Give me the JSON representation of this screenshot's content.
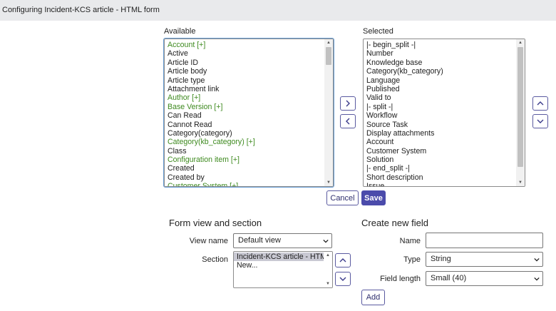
{
  "window": {
    "title": "Configuring Incident-KCS article - HTML form"
  },
  "available": {
    "label": "Available",
    "items": [
      {
        "text": "Account [+]",
        "ref": true
      },
      {
        "text": "Active",
        "ref": false
      },
      {
        "text": "Article ID",
        "ref": false
      },
      {
        "text": "Article body",
        "ref": false
      },
      {
        "text": "Article type",
        "ref": false
      },
      {
        "text": "Attachment link",
        "ref": false
      },
      {
        "text": "Author [+]",
        "ref": true
      },
      {
        "text": "Base Version [+]",
        "ref": true
      },
      {
        "text": "Can Read",
        "ref": false
      },
      {
        "text": "Cannot Read",
        "ref": false
      },
      {
        "text": "Category(category)",
        "ref": false
      },
      {
        "text": "Category(kb_category) [+]",
        "ref": true
      },
      {
        "text": "Class",
        "ref": false
      },
      {
        "text": "Configuration item [+]",
        "ref": true
      },
      {
        "text": "Created",
        "ref": false
      },
      {
        "text": "Created by",
        "ref": false
      },
      {
        "text": "Customer System [+]",
        "ref": true
      }
    ]
  },
  "selected": {
    "label": "Selected",
    "items": [
      "|- begin_split -|",
      "Number",
      "Knowledge base",
      "Category(kb_category)",
      "Language",
      "Published",
      "Valid to",
      "|- split -|",
      "Workflow",
      "Source Task",
      "Display attachments",
      "Account",
      "Customer System",
      "Solution",
      "|- end_split -|",
      "Short description",
      "Issue"
    ]
  },
  "actions": {
    "cancel": "Cancel",
    "save": "Save"
  },
  "form_view": {
    "title": "Form view and section",
    "view_name_label": "View name",
    "view_name_value": "Default view",
    "section_label": "Section",
    "sections": [
      "Incident-KCS article - HTML",
      "New..."
    ]
  },
  "new_field": {
    "title": "Create new field",
    "name_label": "Name",
    "name_value": "",
    "type_label": "Type",
    "type_value": "String",
    "length_label": "Field length",
    "length_value": "Small (40)",
    "add_label": "Add"
  },
  "icons": {
    "add": "chevron-right-icon",
    "remove": "chevron-left-icon",
    "move_up": "chevron-up-icon",
    "move_down": "chevron-down-icon",
    "dropdown": "chevron-down-icon"
  },
  "colors": {
    "accent": "#4b4bab",
    "reference_field": "#3e8a1f",
    "titlebar": "#e9eaec"
  }
}
